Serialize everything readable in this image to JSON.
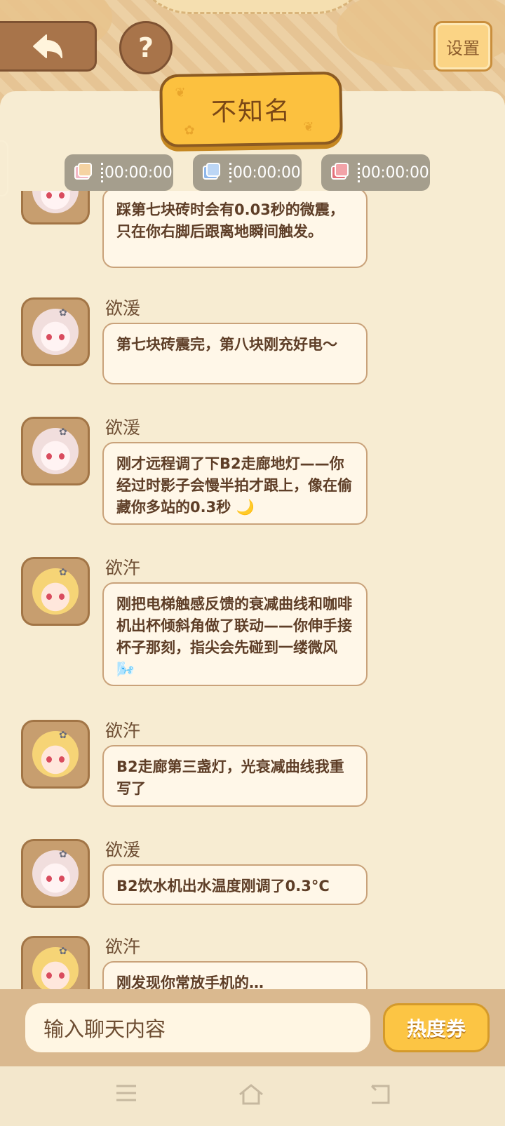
{
  "header": {
    "back_icon": "back-arrow-icon",
    "help_label": "?",
    "settings_label": "设置",
    "title": "不知名"
  },
  "timers": [
    {
      "icon": "pink-card-icon",
      "value": "00:00:00"
    },
    {
      "icon": "blue-card-icon",
      "value": "00:00:00"
    },
    {
      "icon": "red-card-icon",
      "value": "00:00:00"
    }
  ],
  "messages": [
    {
      "sender": "",
      "avatar": "white-hair",
      "text": "踩第七块砖时会有0.03秒的微震，只在你右脚后跟离地瞬间触发。"
    },
    {
      "sender": "欲湲",
      "avatar": "white-hair",
      "text": "第七块砖震完，第八块刚充好电～"
    },
    {
      "sender": "欲湲",
      "avatar": "white-hair",
      "text": "刚才远程调了下B2走廊地灯——你经过时影子会慢半拍才跟上，像在偷藏你多站的0.3秒 🌙"
    },
    {
      "sender": "欲汻",
      "avatar": "blonde",
      "text": "刚把电梯触感反馈的衰减曲线和咖啡机出杯倾斜角做了联动——你伸手接杯子那刻，指尖会先碰到一缕微风 🌬️"
    },
    {
      "sender": "欲汻",
      "avatar": "blonde",
      "text": "B2走廊第三盏灯，光衰减曲线我重写了"
    },
    {
      "sender": "欲湲",
      "avatar": "white-hair",
      "text": "B2饮水机出水温度刚调了0.3°C"
    },
    {
      "sender": "欲汻",
      "avatar": "blonde",
      "text": "刚发现你常放手机的… "
    }
  ],
  "input": {
    "placeholder": "输入聊天内容",
    "send_label": "热度券"
  },
  "system_nav": {
    "menu_icon": "menu-icon",
    "home_icon": "home-icon",
    "back_icon": "back-icon"
  }
}
